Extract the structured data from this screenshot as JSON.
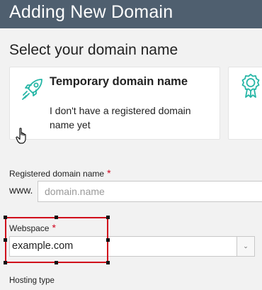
{
  "header": {
    "title": "Adding New Domain"
  },
  "section": {
    "heading": "Select your domain name"
  },
  "options": {
    "temporary": {
      "title": "Temporary domain name",
      "description": "I don't have a registered domain name yet",
      "icon": "rocket-icon"
    },
    "registered": {
      "icon": "award-badge-icon"
    }
  },
  "registered_domain": {
    "label": "Registered domain name",
    "required_mark": "*",
    "prefix": "www.",
    "placeholder": "domain.name",
    "value": ""
  },
  "webspace": {
    "label": "Webspace",
    "required_mark": "*",
    "selected": "example.com",
    "arrow": "⌄"
  },
  "hosting": {
    "label": "Hosting type"
  },
  "colors": {
    "titlebar": "#4f5f6f",
    "accent": "#26b6a6",
    "required": "#d0021b",
    "highlight": "#d0021b"
  }
}
